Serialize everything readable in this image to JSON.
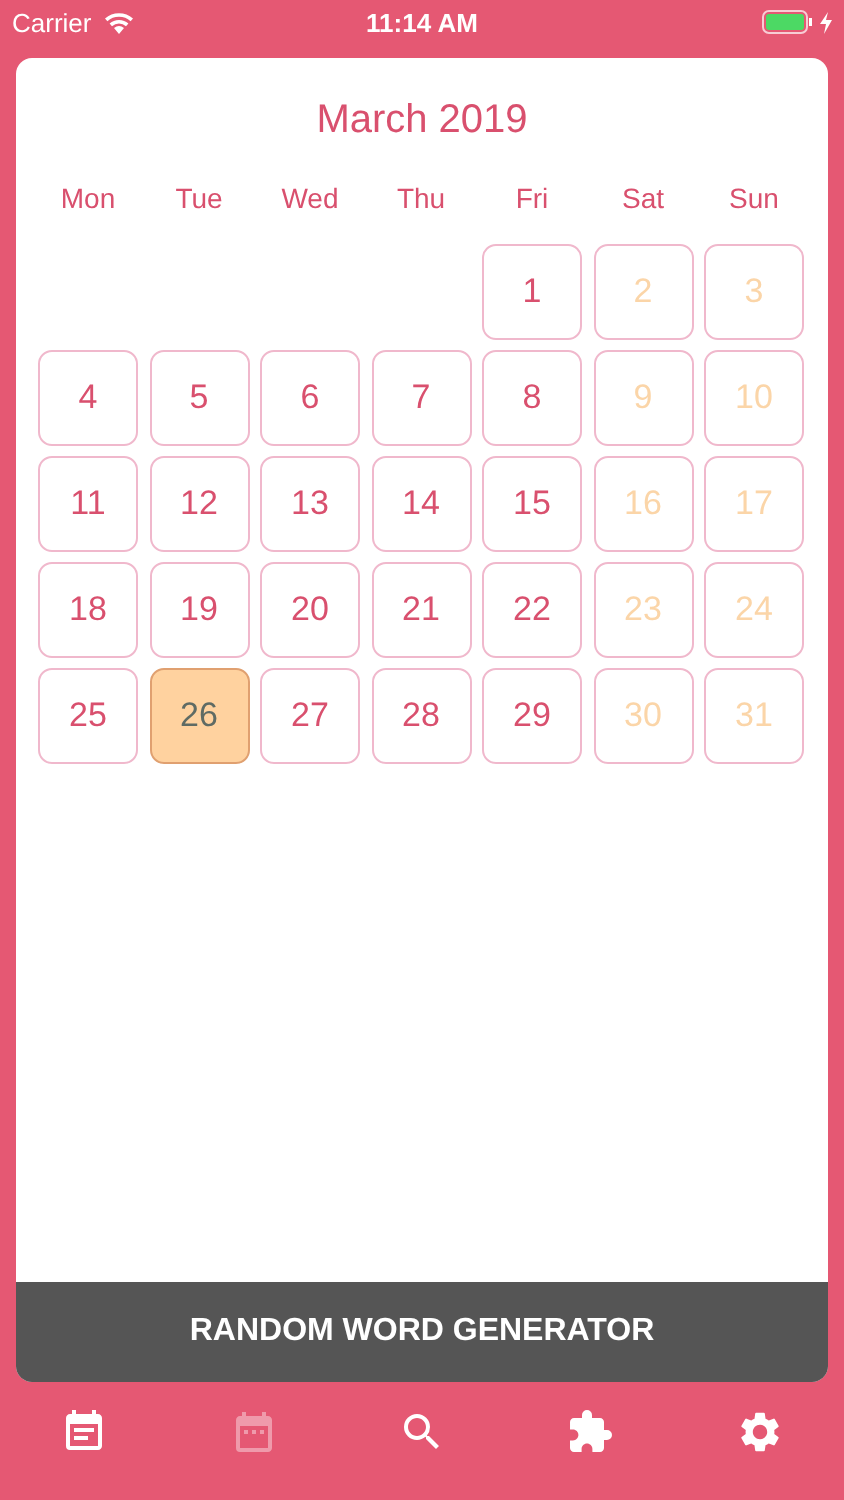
{
  "status_bar": {
    "carrier": "Carrier",
    "time": "11:14 AM"
  },
  "calendar": {
    "title": "March 2019",
    "weekdays": [
      "Mon",
      "Tue",
      "Wed",
      "Thu",
      "Fri",
      "Sat",
      "Sun"
    ],
    "days": [
      {
        "label": "1",
        "kind": "weekday",
        "selected": false
      },
      {
        "label": "2",
        "kind": "weekend",
        "selected": false
      },
      {
        "label": "3",
        "kind": "weekend",
        "selected": false
      },
      {
        "label": "4",
        "kind": "weekday",
        "selected": false
      },
      {
        "label": "5",
        "kind": "weekday",
        "selected": false
      },
      {
        "label": "6",
        "kind": "weekday",
        "selected": false
      },
      {
        "label": "7",
        "kind": "weekday",
        "selected": false
      },
      {
        "label": "8",
        "kind": "weekday",
        "selected": false
      },
      {
        "label": "9",
        "kind": "weekend",
        "selected": false
      },
      {
        "label": "10",
        "kind": "weekend",
        "selected": false
      },
      {
        "label": "11",
        "kind": "weekday",
        "selected": false
      },
      {
        "label": "12",
        "kind": "weekday",
        "selected": false
      },
      {
        "label": "13",
        "kind": "weekday",
        "selected": false
      },
      {
        "label": "14",
        "kind": "weekday",
        "selected": false
      },
      {
        "label": "15",
        "kind": "weekday",
        "selected": false
      },
      {
        "label": "16",
        "kind": "weekend",
        "selected": false
      },
      {
        "label": "17",
        "kind": "weekend",
        "selected": false
      },
      {
        "label": "18",
        "kind": "weekday",
        "selected": false
      },
      {
        "label": "19",
        "kind": "weekday",
        "selected": false
      },
      {
        "label": "20",
        "kind": "weekday",
        "selected": false
      },
      {
        "label": "21",
        "kind": "weekday",
        "selected": false
      },
      {
        "label": "22",
        "kind": "weekday",
        "selected": false
      },
      {
        "label": "23",
        "kind": "weekend",
        "selected": false
      },
      {
        "label": "24",
        "kind": "weekend",
        "selected": false
      },
      {
        "label": "25",
        "kind": "weekday",
        "selected": false
      },
      {
        "label": "26",
        "kind": "weekday",
        "selected": true
      },
      {
        "label": "27",
        "kind": "weekday",
        "selected": false
      },
      {
        "label": "28",
        "kind": "weekday",
        "selected": false
      },
      {
        "label": "29",
        "kind": "weekday",
        "selected": false
      },
      {
        "label": "30",
        "kind": "weekend",
        "selected": false
      },
      {
        "label": "31",
        "kind": "weekend",
        "selected": false
      }
    ]
  },
  "generate_button": "RANDOM WORD GENERATOR",
  "tab_bar": [
    {
      "kind": "notes",
      "disabled": false
    },
    {
      "kind": "calendar",
      "disabled": true
    },
    {
      "kind": "search",
      "disabled": false
    },
    {
      "kind": "puzzle",
      "disabled": false
    },
    {
      "kind": "settings",
      "disabled": false
    }
  ]
}
